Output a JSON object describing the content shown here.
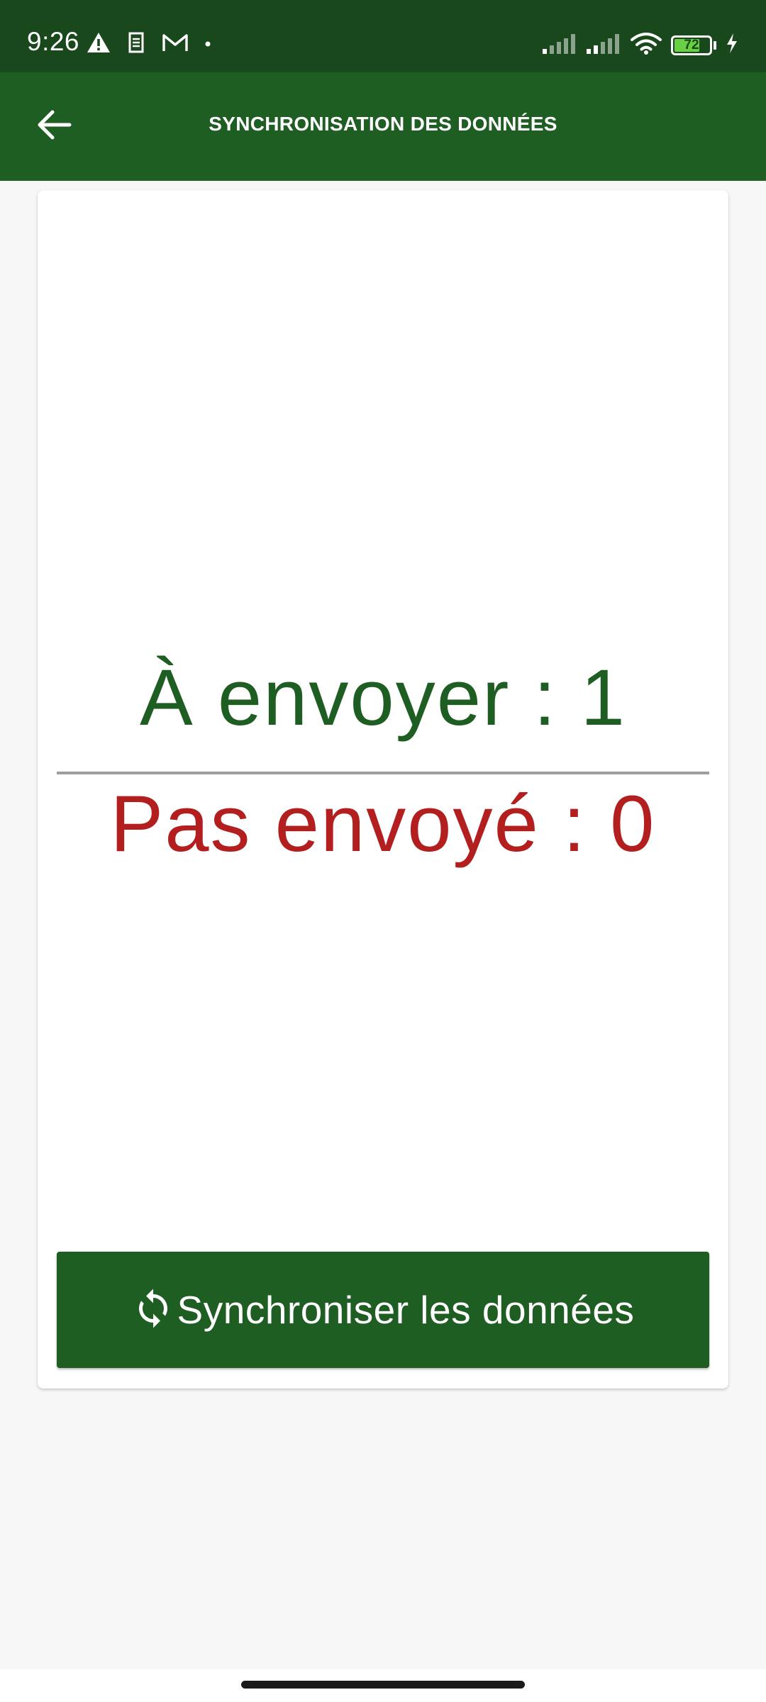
{
  "status_bar": {
    "time": "9:26",
    "battery_level": "72",
    "battery_fraction": 0.72,
    "battery_color": "#6ad043",
    "icons": [
      "alert-icon",
      "sim-icon",
      "gmail-icon",
      "dot-icon",
      "signal-icon",
      "signal-icon",
      "wifi-icon",
      "battery-icon",
      "charging-icon"
    ]
  },
  "app_bar": {
    "title": "SYNCHRONISATION DES DONNÉES",
    "back_icon": "arrow-left-icon",
    "color": "#1e5e22"
  },
  "sync_status": {
    "to_send": "À envoyer : 1",
    "not_sent": "Pas envoyé : 0",
    "to_send_color": "#1e5e22",
    "not_sent_color": "#b31f1f"
  },
  "sync_button": {
    "label": "Synchroniser les données",
    "icon": "sync-icon"
  }
}
